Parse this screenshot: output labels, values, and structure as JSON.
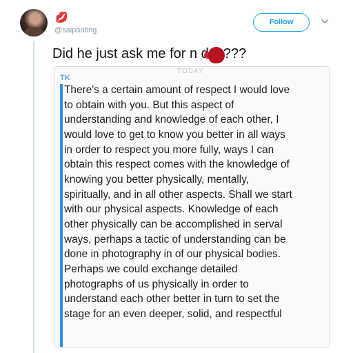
{
  "tweet": {
    "handle": "@saipanting",
    "name_emoji": "💋",
    "follow_label": "Follow",
    "text": "Did he just ask me for n   des???"
  },
  "screenshot": {
    "date_label": "TODAY",
    "sender": "TK",
    "message": "There's a certain amount of respect I would love\nto obtain with you.  But this aspect of\nunderstanding and knowledge of each other, I\nwould love to get to know you better in all ways\nin order to respect you more fully, ways I can\nobtain this respect comes with the knowledge of\nknowing you better physically, mentally,\nspiritually, and in all other aspects. Shall we start\nwith our physical aspects. Knowledge of each\nother physically can be accomplished in serval\nways, perhaps a tactic of understanding can be\ndone in photography in of our physical bodies.\nPerhaps we could exchange detailed\nphotographs of us physically in order to\nunderstand each other better in turn to set the\nstage for an even deeper, solid, and respectful"
  },
  "icons": {
    "avatar": "profile-photo",
    "chevron": "chevron-down-icon",
    "redaction": "red-blot"
  },
  "colors": {
    "accent": "#1da1f2",
    "sender_bar": "#2f8fe5",
    "redaction": "#b8141f"
  }
}
